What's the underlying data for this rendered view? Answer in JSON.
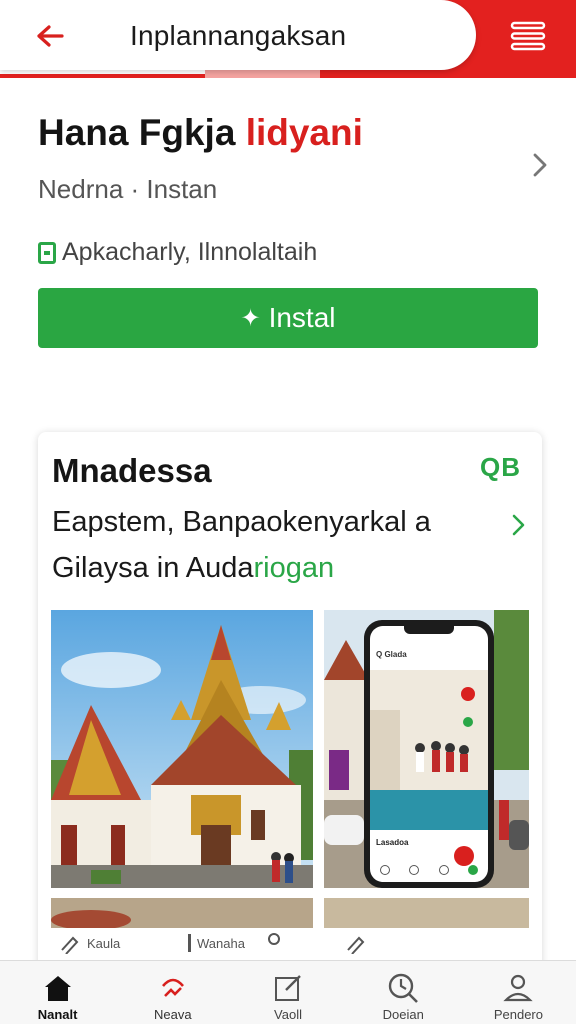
{
  "topbar": {
    "title": "Inplannangaksan",
    "back_icon": "arrow-left-icon",
    "menu_icon": "menu-icon",
    "accent_color": "#e3211f"
  },
  "hero": {
    "title_main": "Hana Fgkja ",
    "title_accent": "lidyani",
    "subtitle": "Nedrna · Instan",
    "feature_text": "Apkacharly, Ilnnolaltaih",
    "install_label": "Instal",
    "install_color": "#2aa642"
  },
  "card": {
    "title": "Mnadessa",
    "badge": "QB",
    "desc_line1": "Eapstem, Banpaokenyarkal a",
    "desc_line2_main": "Gilaysa in Auda",
    "desc_line2_accent": "riogan",
    "phone_header": "Q  Glada",
    "phone_caption": "Lasadoa",
    "mini_items": [
      "Kaula",
      "Wanaha",
      "",
      ""
    ]
  },
  "bottom_nav": {
    "items": [
      {
        "label": "Nanalt",
        "icon": "home-icon"
      },
      {
        "label": "Neava",
        "icon": "alert-icon"
      },
      {
        "label": "Vaoll",
        "icon": "edit-icon"
      },
      {
        "label": "Doeian",
        "icon": "clock-search-icon"
      },
      {
        "label": "Pendero",
        "icon": "profile-icon"
      }
    ]
  }
}
